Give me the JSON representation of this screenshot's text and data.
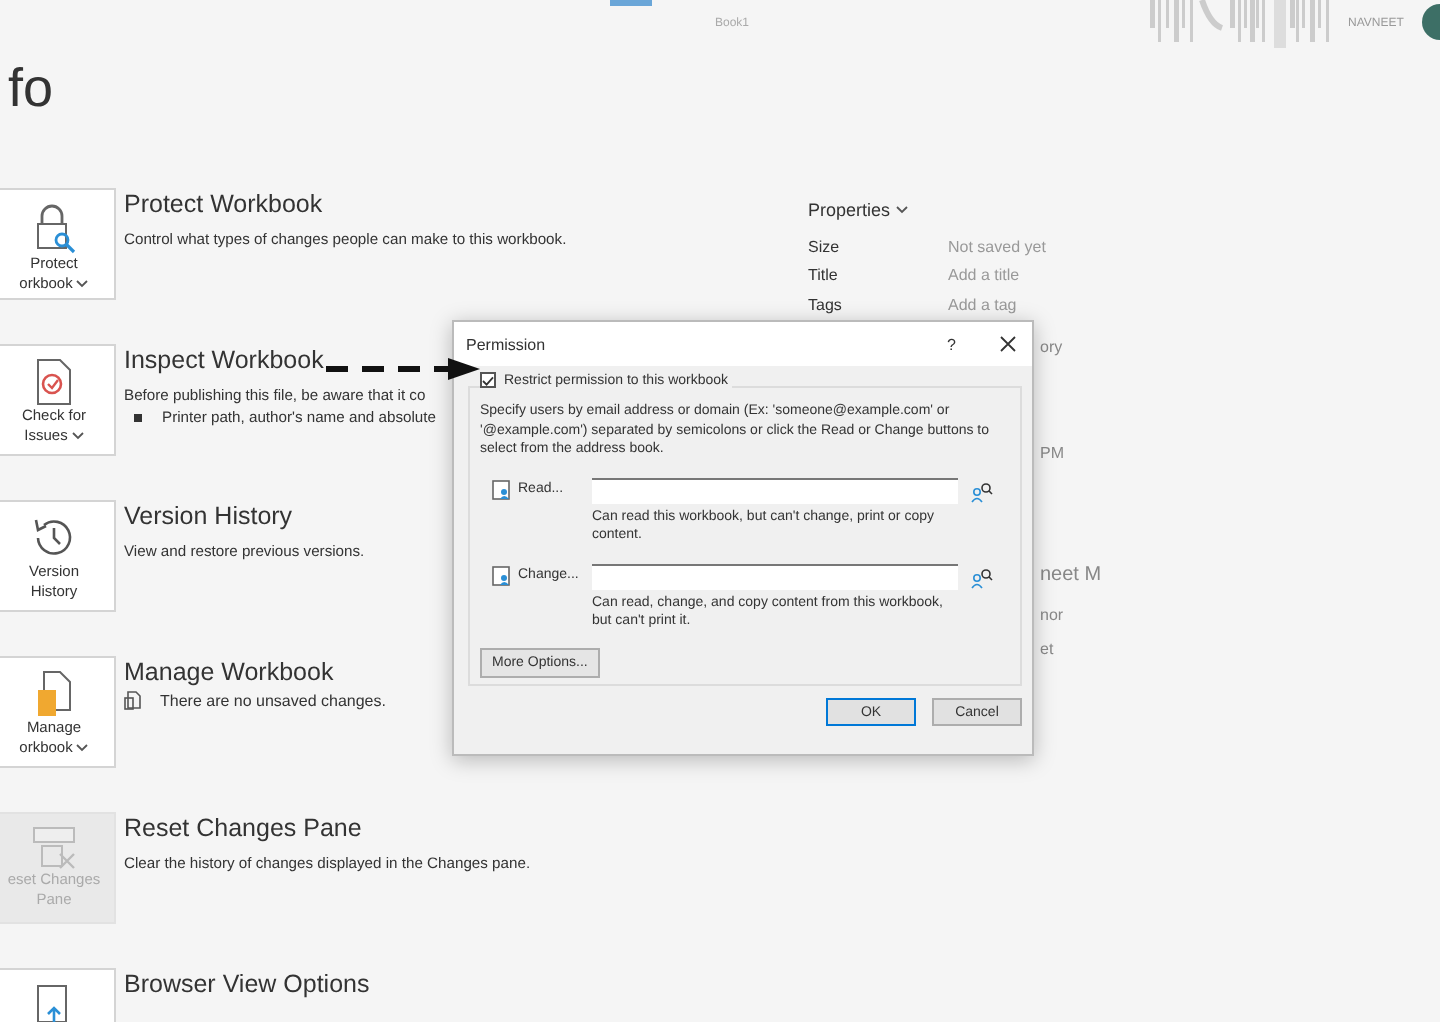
{
  "header": {
    "document_title": "Book1",
    "user_name": "NAVNEET"
  },
  "page_title": "fo",
  "sections": [
    {
      "tile_lines": [
        "Protect",
        "orkbook"
      ],
      "dropdown": true,
      "disabled": false,
      "title": "Protect Workbook",
      "description": "Control what types of changes people can make to this workbook."
    },
    {
      "tile_lines": [
        "Check for",
        "Issues"
      ],
      "dropdown": true,
      "disabled": false,
      "title": "Inspect Workbook",
      "description": "Before publishing this file, be aware that it co",
      "bullets": [
        "Printer path, author's name and absolute"
      ]
    },
    {
      "tile_lines": [
        "Version",
        "History"
      ],
      "dropdown": false,
      "disabled": false,
      "title": "Version History",
      "description": "View and restore previous versions."
    },
    {
      "tile_lines": [
        "Manage",
        "orkbook"
      ],
      "dropdown": true,
      "disabled": false,
      "title": "Manage Workbook",
      "note": "There are no unsaved changes."
    },
    {
      "tile_lines": [
        "eset Changes",
        "Pane"
      ],
      "dropdown": false,
      "disabled": true,
      "title": "Reset Changes Pane",
      "description": "Clear the history of changes displayed in the Changes pane."
    },
    {
      "disabled": false,
      "title": "Browser View Options"
    }
  ],
  "properties": {
    "heading": "Properties",
    "items": [
      {
        "label": "Size",
        "value": "Not saved yet"
      },
      {
        "label": "Title",
        "value": "Add a title"
      },
      {
        "label": "Tags",
        "value": "Add a tag"
      }
    ],
    "obscured_values": [
      "ory",
      "PM",
      "neet M",
      "nor",
      "et"
    ]
  },
  "dialog": {
    "title": "Permission",
    "help": "?",
    "restrict": {
      "label": "Restrict permission to this workbook",
      "checked": true
    },
    "instructions": "Specify users by email address or domain (Ex: 'someone@example.com' or '@example.com') separated by semicolons or click the Read or Change buttons to select from the address book.",
    "permissions": [
      {
        "button": "Read...",
        "hint": "Can read this workbook, but can't change, print or copy content."
      },
      {
        "button": "Change...",
        "hint": "Can read, change, and copy content from this workbook, but can't print it."
      }
    ],
    "more_options": "More Options...",
    "buttons": [
      {
        "label": "OK",
        "default": true
      },
      {
        "label": "Cancel",
        "default": false
      }
    ]
  }
}
